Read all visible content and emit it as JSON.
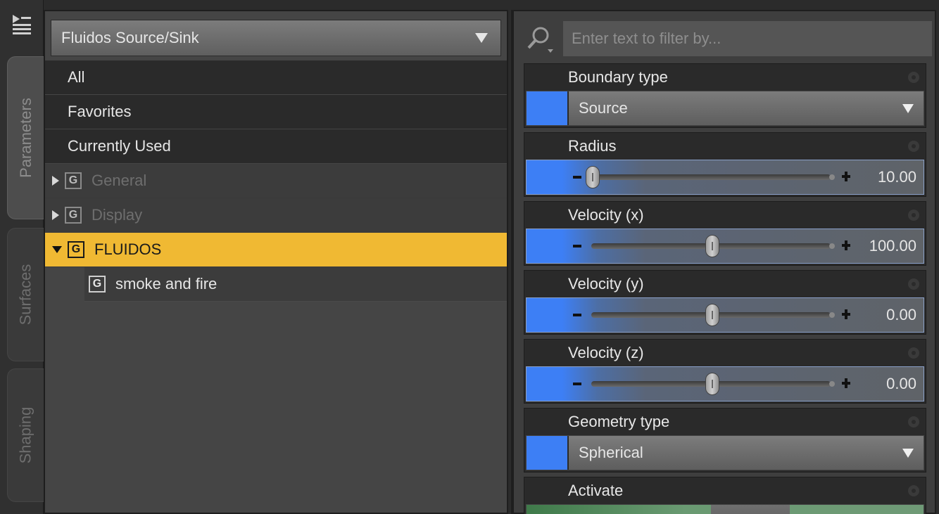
{
  "side_tabs": [
    "Parameters",
    "Surfaces",
    "Shaping"
  ],
  "left": {
    "category_select": "Fluidos Source/Sink",
    "top_items": [
      "All",
      "Favorites",
      "Currently Used"
    ],
    "groups": [
      {
        "icon": "G",
        "label": "General"
      },
      {
        "icon": "G",
        "label": "Display"
      },
      {
        "icon": "G",
        "label": "FLUIDOS"
      }
    ],
    "child": {
      "icon": "G",
      "label": "smoke and fire"
    }
  },
  "right": {
    "filter_placeholder": "Enter text to filter by...",
    "params": [
      {
        "label": "Boundary type",
        "kind": "combo",
        "value": "Source"
      },
      {
        "label": "Radius",
        "kind": "slider",
        "value": "10.00",
        "position": 0.0
      },
      {
        "label": "Velocity (x)",
        "kind": "slider",
        "value": "100.00",
        "position": 0.5
      },
      {
        "label": "Velocity (y)",
        "kind": "slider",
        "value": "0.00",
        "position": 0.5
      },
      {
        "label": "Velocity (z)",
        "kind": "slider",
        "value": "0.00",
        "position": 0.5
      },
      {
        "label": "Geometry type",
        "kind": "combo",
        "value": "Spherical"
      },
      {
        "label": "Activate",
        "kind": "toggle"
      }
    ]
  },
  "colors": {
    "accent": "#3d7ff5",
    "selection": "#f0b933"
  }
}
